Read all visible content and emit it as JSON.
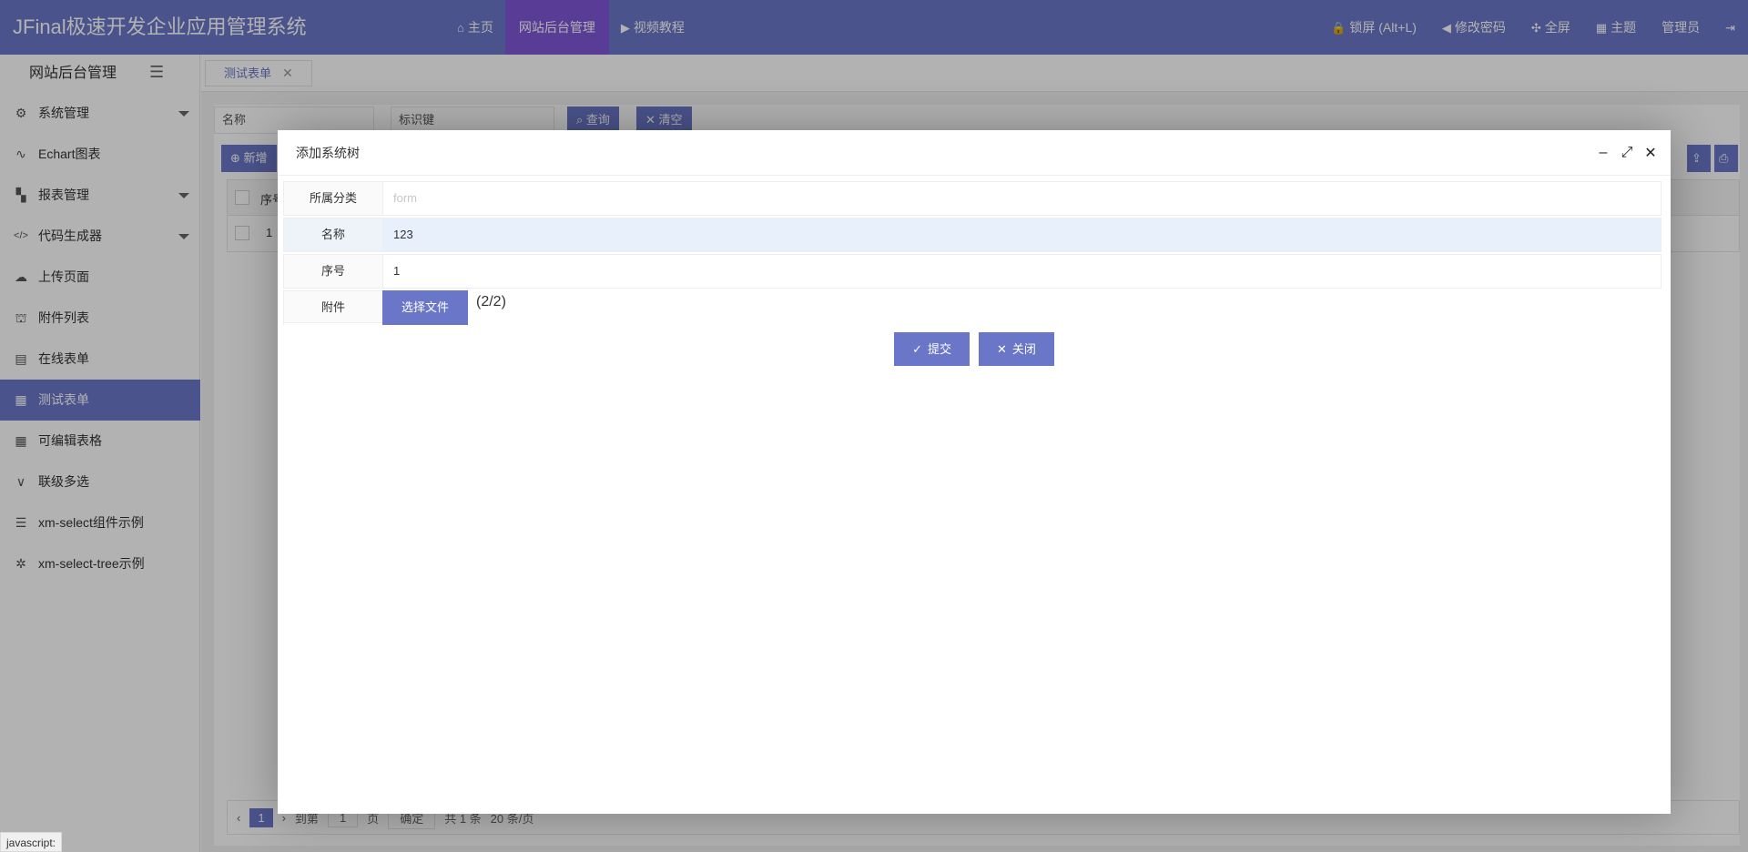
{
  "header": {
    "brand": "JFinal极速开发企业应用管理系统",
    "nav": [
      {
        "icon": "home-icon",
        "glyph": "⌂",
        "label": "主页"
      },
      {
        "label": "网站后台管理",
        "active": true
      },
      {
        "icon": "video-icon",
        "glyph": "▶",
        "label": "视频教程"
      }
    ],
    "right": [
      {
        "icon": "lock-icon",
        "glyph": "🔒",
        "label": "锁屏 (Alt+L)"
      },
      {
        "icon": "speaker-icon",
        "glyph": "◀",
        "label": "修改密码"
      },
      {
        "icon": "fullscreen-icon",
        "glyph": "✣",
        "label": "全屏"
      },
      {
        "icon": "grid-icon",
        "glyph": "▦",
        "label": "主题"
      },
      {
        "label": "管理员"
      },
      {
        "icon": "logout-icon",
        "glyph": "⇥",
        "label": ""
      }
    ]
  },
  "sidebar": {
    "title": "网站后台管理",
    "items": [
      {
        "icon": "gear-icon",
        "glyph": "⚙",
        "label": "系统管理",
        "caret": true
      },
      {
        "icon": "pulse-icon",
        "glyph": "∿",
        "label": "Echart图表"
      },
      {
        "icon": "apps-icon",
        "glyph": "▚",
        "label": "报表管理",
        "caret": true
      },
      {
        "icon": "code-icon",
        "glyph": "</>",
        "label": "代码生成器",
        "caret": true
      },
      {
        "icon": "upload-cloud-icon",
        "glyph": "☁",
        "label": "上传页面"
      },
      {
        "icon": "attachment-icon",
        "glyph": "⛫",
        "label": "附件列表"
      },
      {
        "icon": "form-icon",
        "glyph": "▤",
        "label": "在线表单"
      },
      {
        "icon": "table-icon",
        "glyph": "▦",
        "label": "测试表单",
        "active": true
      },
      {
        "icon": "table-icon",
        "glyph": "▦",
        "label": "可编辑表格"
      },
      {
        "icon": "chevron-down-icon",
        "glyph": "∨",
        "label": "联级多选"
      },
      {
        "icon": "sliders-icon",
        "glyph": "☰",
        "label": "xm-select组件示例"
      },
      {
        "icon": "tree-icon",
        "glyph": "✲",
        "label": "xm-select-tree示例"
      }
    ]
  },
  "tabs": [
    {
      "label": "测试表单"
    }
  ],
  "background": {
    "search_name": "名称",
    "search_key": "标识键",
    "query_label": "查询",
    "clear_label": "清空",
    "add_label": "新增",
    "col_index": "序号",
    "row_index": "1",
    "pager": {
      "current": "1",
      "goto": "到第",
      "page_input": "1",
      "page_unit": "页",
      "confirm": "确定",
      "total": "共 1 条",
      "per_page": "20 条/页"
    }
  },
  "modal": {
    "title": "添加系统树",
    "fields": [
      {
        "label": "所属分类",
        "value": "",
        "placeholder": "form"
      },
      {
        "label": "名称",
        "value": "123"
      },
      {
        "label": "序号",
        "value": "1"
      }
    ],
    "attachment_label": "附件",
    "file_button": "选择文件",
    "file_count": "(2/2)",
    "submit_label": "提交",
    "close_label": "关闭"
  },
  "status_bar": "javascript:"
}
